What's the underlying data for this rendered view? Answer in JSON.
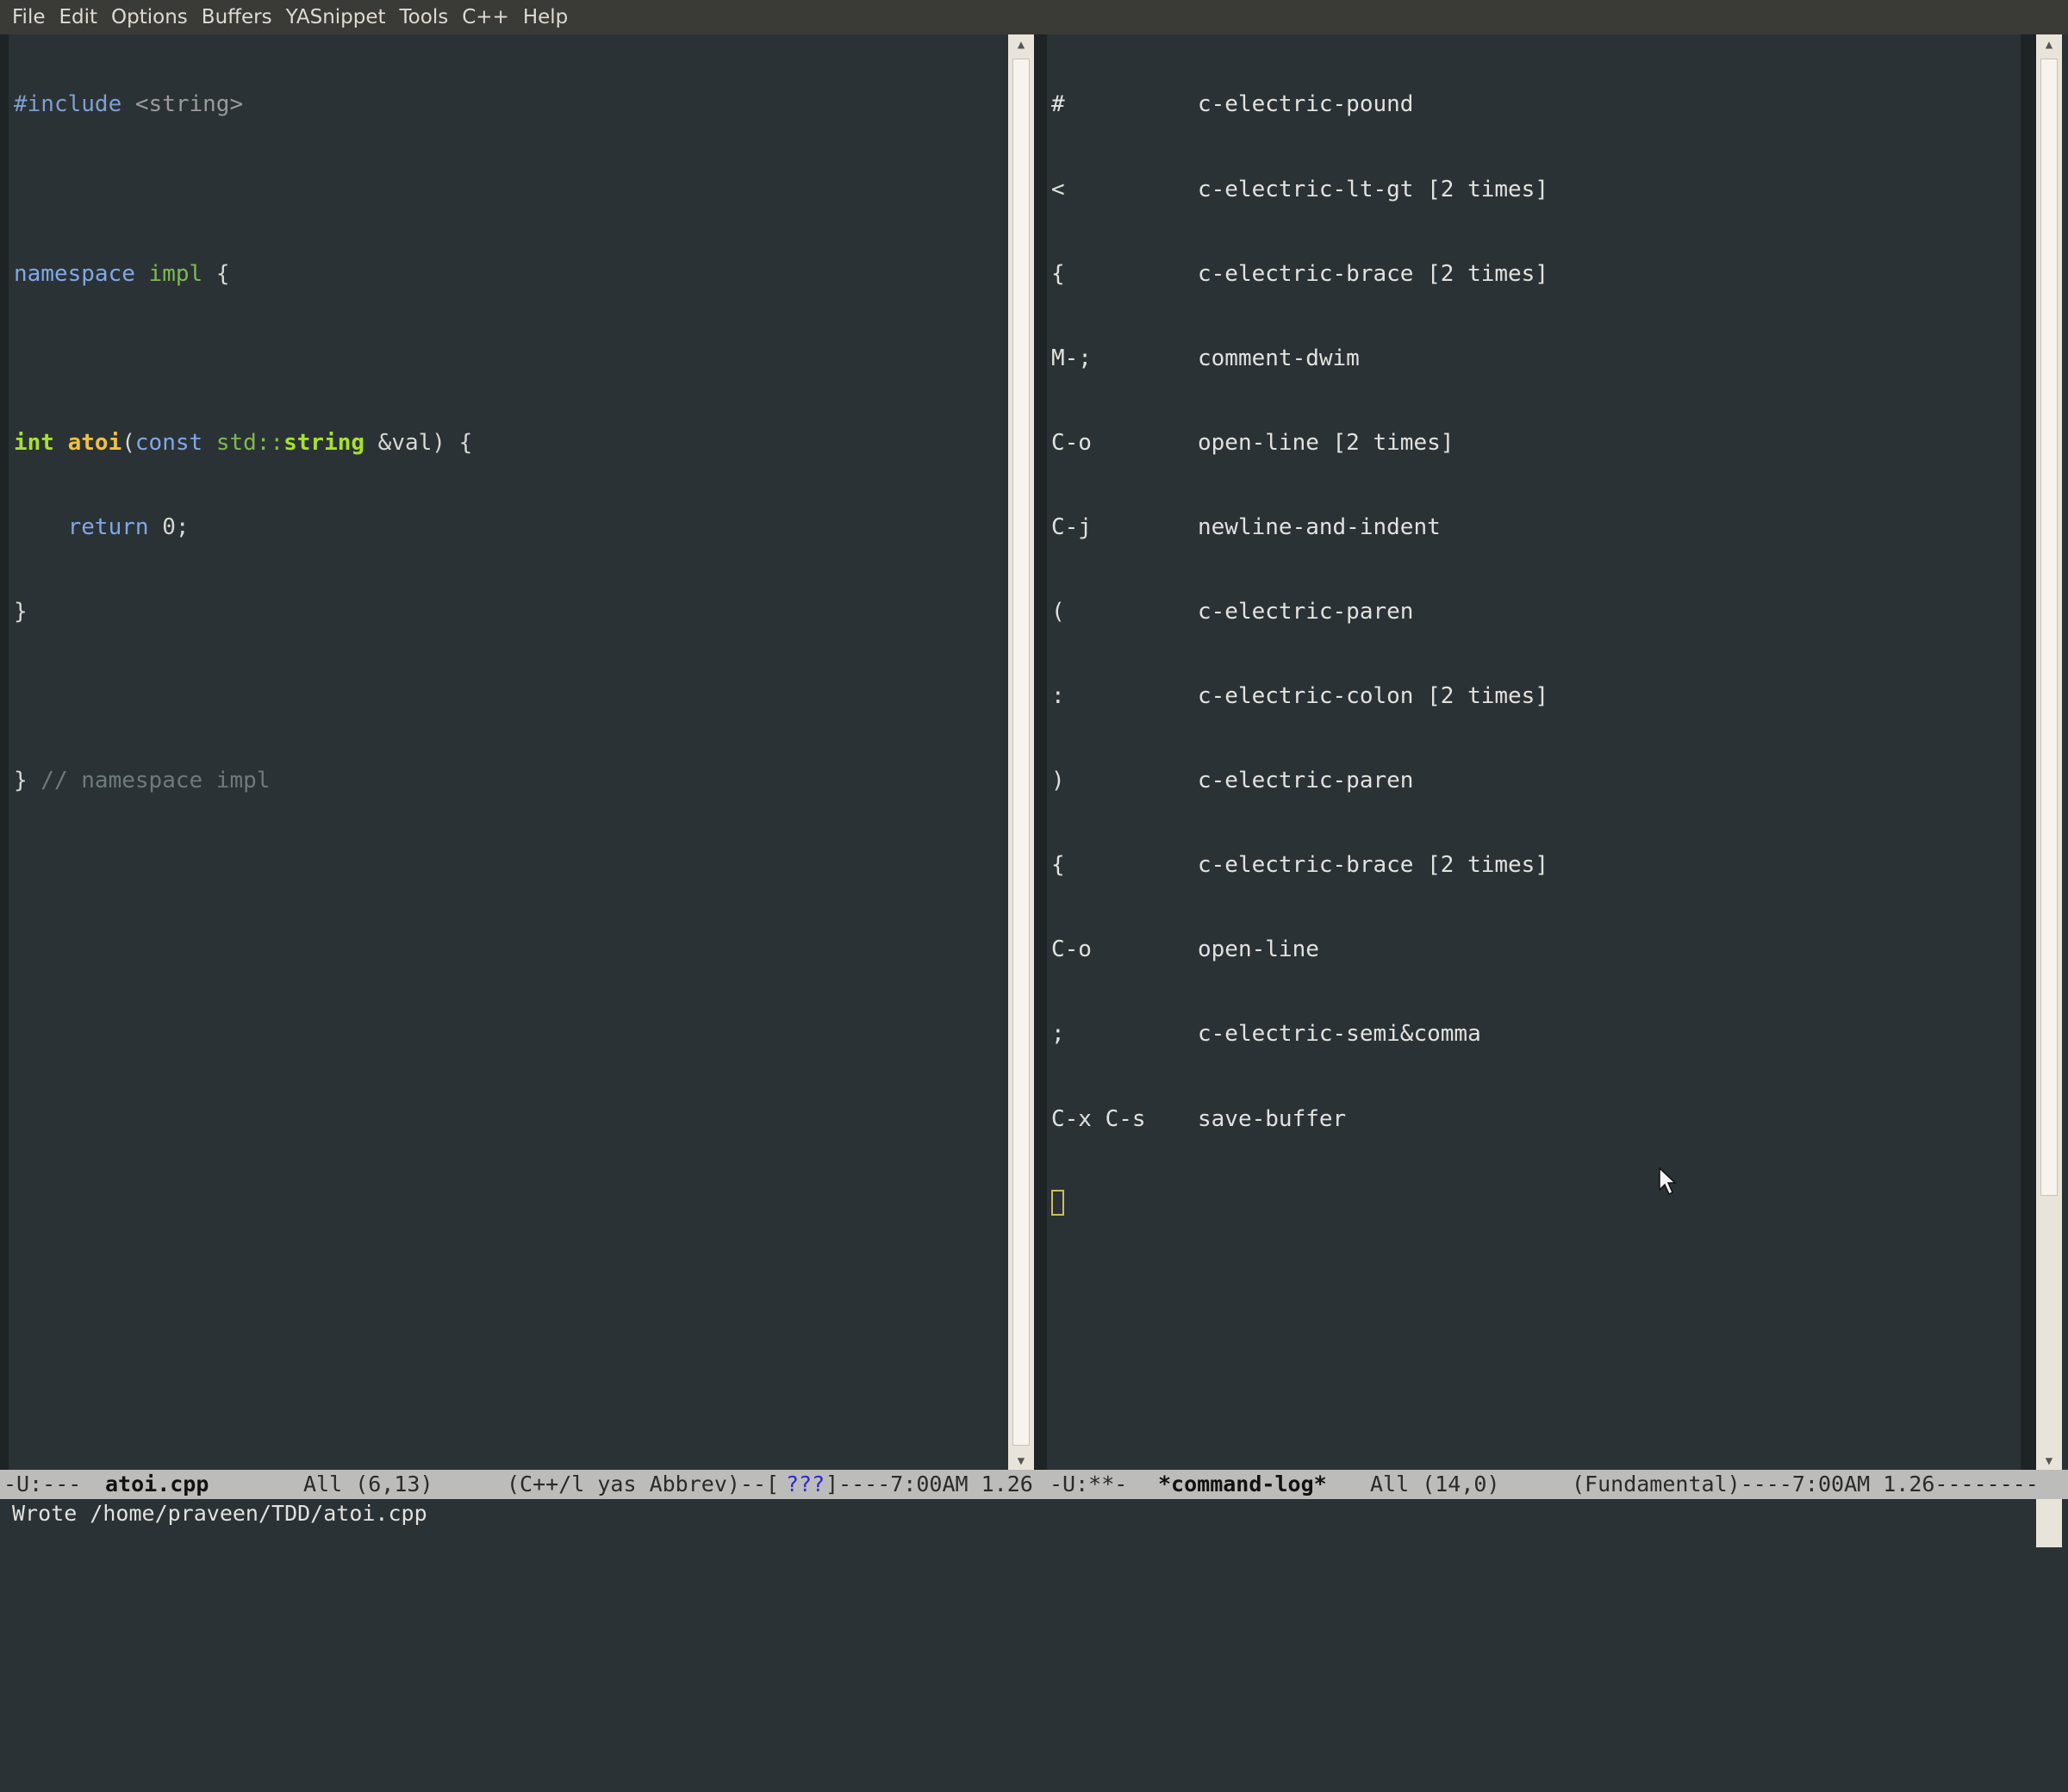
{
  "menubar": {
    "items": [
      "File",
      "Edit",
      "Options",
      "Buffers",
      "YASnippet",
      "Tools",
      "C++",
      "Help"
    ]
  },
  "left_buffer": {
    "lines": {
      "l1_a": "#include",
      "l1_b": " <string>",
      "l3_a": "namespace",
      "l3_b": " impl",
      "l3_c": " {",
      "l5_a": "int",
      "l5_b": " atoi",
      "l5_c": "(",
      "l5_d": "const",
      "l5_e": " std::",
      "l5_f": "string",
      "l5_g": " &val) {",
      "l6_a": "    return",
      "l6_b": " 0;",
      "l7": "}",
      "l9_a": "}",
      "l9_b": " // namespace impl"
    }
  },
  "right_buffer": {
    "entries": [
      {
        "key": "#",
        "command": "c-electric-pound"
      },
      {
        "key": "<",
        "command": "c-electric-lt-gt [2 times]"
      },
      {
        "key": "{",
        "command": "c-electric-brace [2 times]"
      },
      {
        "key": "M-;",
        "command": "comment-dwim"
      },
      {
        "key": "C-o",
        "command": "open-line [2 times]"
      },
      {
        "key": "C-j",
        "command": "newline-and-indent"
      },
      {
        "key": "(",
        "command": "c-electric-paren"
      },
      {
        "key": ":",
        "command": "c-electric-colon [2 times]"
      },
      {
        "key": ")",
        "command": "c-electric-paren"
      },
      {
        "key": "{",
        "command": "c-electric-brace [2 times]"
      },
      {
        "key": "C-o",
        "command": "open-line"
      },
      {
        "key": ";",
        "command": "c-electric-semi&comma"
      },
      {
        "key": "C-x C-s",
        "command": "save-buffer"
      }
    ]
  },
  "modeline": {
    "left_status": "-U:---",
    "left_buffer_name": "atoi.cpp",
    "left_position": "All (6,13)",
    "left_modes": "(C++/l yas Abbrev)--[",
    "left_modes_tail": "]----7:00AM 1.26",
    "right_status": "-U:**-",
    "right_buffer_name": "*command-log*",
    "right_position": "All (14,0)",
    "right_modes": "(Fundamental)----7:00AM 1.26--------"
  },
  "echo_area": {
    "message": "Wrote /home/praveen/TDD/atoi.cpp"
  }
}
